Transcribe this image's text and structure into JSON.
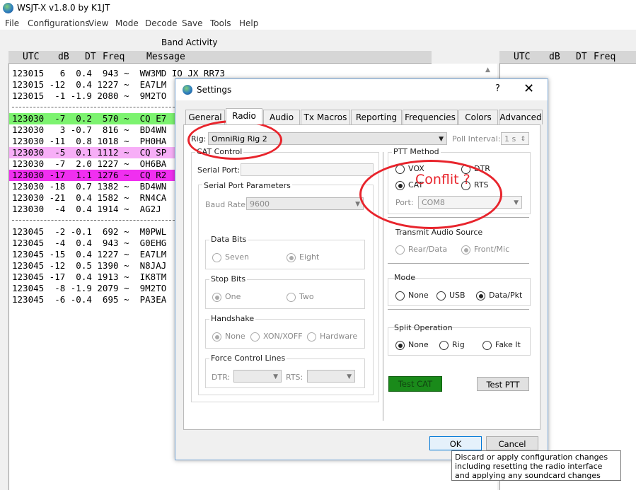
{
  "app": {
    "title": "WSJT-X   v1.8.0   by K1JT"
  },
  "menu": [
    "File",
    "Configurations",
    "View",
    "Mode",
    "Decode",
    "Save",
    "Tools",
    "Help"
  ],
  "band_activity": {
    "label": "Band Activity",
    "header": {
      "utc": "UTC",
      "db": "dB",
      "dt": "DT",
      "freq": "Freq",
      "message": "Message"
    },
    "rows": [
      {
        "text": "123015   6  0.4  943 ~  WW3MD IO JX RR73",
        "bg": ""
      },
      {
        "text": "123015 -12  0.4 1227 ~  EA7LM",
        "bg": ""
      },
      {
        "text": "123015  -1 -1.9 2080 ~  9M2TO",
        "bg": ""
      },
      {
        "text": "123030  -7  0.2  570 ~  CQ E7",
        "bg": "#7cf36f"
      },
      {
        "text": "123030   3 -0.7  816 ~  BD4WN",
        "bg": ""
      },
      {
        "text": "123030 -11  0.8 1018 ~  PH0HA",
        "bg": ""
      },
      {
        "text": "123030  -5  0.1 1112 ~  CQ SP",
        "bg": "#f7aef7"
      },
      {
        "text": "123030  -7  2.0 1227 ~  OH6BA",
        "bg": ""
      },
      {
        "text": "123030 -17  1.1 1276 ~  CQ R2",
        "bg": "#f02ff0"
      },
      {
        "text": "123030 -18  0.7 1382 ~  BD4WN",
        "bg": ""
      },
      {
        "text": "123030 -21  0.4 1582 ~  RN4CA",
        "bg": ""
      },
      {
        "text": "123030  -4  0.4 1914 ~  AG2J",
        "bg": ""
      },
      {
        "text": "123045  -2 -0.1  692 ~  M0PWL",
        "bg": ""
      },
      {
        "text": "123045  -4  0.4  943 ~  G0EHG",
        "bg": ""
      },
      {
        "text": "123045 -15  0.4 1227 ~  EA7LM",
        "bg": ""
      },
      {
        "text": "123045 -12  0.5 1390 ~  N8JAJ",
        "bg": ""
      },
      {
        "text": "123045 -17  0.4 1913 ~  IK8TM",
        "bg": ""
      },
      {
        "text": "123045  -8 -1.9 2079 ~  9M2TO",
        "bg": ""
      },
      {
        "text": "123045  -6 -0.4  695 ~  PA3EA",
        "bg": ""
      }
    ]
  },
  "rx_frequency": {
    "header": {
      "utc": "UTC",
      "db": "dB",
      "dt": "DT",
      "freq": "Freq"
    }
  },
  "settings": {
    "title": "Settings",
    "help": "?",
    "close": "✕",
    "tabs": [
      "General",
      "Radio",
      "Audio",
      "Tx Macros",
      "Reporting",
      "Frequencies",
      "Colors",
      "Advanced"
    ],
    "active_tab": "Radio",
    "rig_label": "Rig:",
    "rig_value": "OmniRig Rig 2",
    "poll_label": "Poll Interval:",
    "poll_value": "1 s",
    "cat_control": {
      "title": "CAT Control",
      "serial_port_label": "Serial Port:",
      "serial_params_title": "Serial Port Parameters",
      "baud_label": "Baud Rate:",
      "baud_value": "9600",
      "data_bits": {
        "title": "Data Bits",
        "seven": "Seven",
        "eight": "Eight"
      },
      "stop_bits": {
        "title": "Stop Bits",
        "one": "One",
        "two": "Two"
      },
      "handshake": {
        "title": "Handshake",
        "none": "None",
        "xonxoff": "XON/XOFF",
        "hardware": "Hardware"
      },
      "force_lines": {
        "title": "Force Control Lines",
        "dtr": "DTR:",
        "rts": "RTS:"
      }
    },
    "ptt": {
      "title": "PTT Method",
      "vox": "VOX",
      "dtr": "DTR",
      "cat": "CAT",
      "rts": "RTS",
      "port_label": "Port:",
      "port_value": "COM8"
    },
    "tx_audio": {
      "title": "Transmit Audio Source",
      "rear": "Rear/Data",
      "front": "Front/Mic"
    },
    "mode": {
      "title": "Mode",
      "none": "None",
      "usb": "USB",
      "data": "Data/Pkt"
    },
    "split": {
      "title": "Split Operation",
      "none": "None",
      "rig": "Rig",
      "fake": "Fake It"
    },
    "test_cat": "Test CAT",
    "test_cat_color": "#1a8a1a",
    "test_ptt": "Test PTT",
    "ok": "OK",
    "cancel": "Cancel"
  },
  "tooltip": "Discard or apply configuration changes including resetting the radio interface and applying any soundcard changes",
  "annotation": {
    "text": "Conflit ?",
    "color": "#e8242c"
  }
}
